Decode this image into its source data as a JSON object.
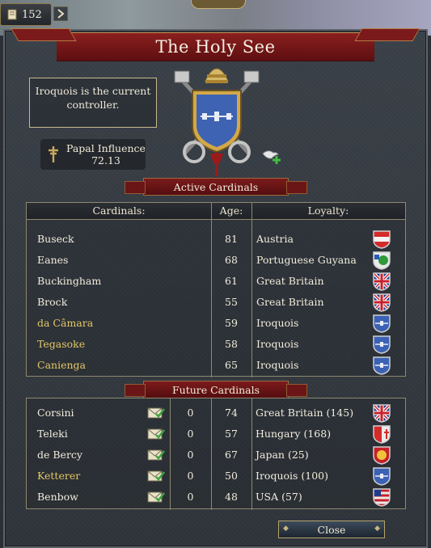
{
  "topbar": {
    "counter": "152"
  },
  "window": {
    "title": "The Holy See",
    "controller_text": "Iroquois is the current controller.",
    "influence_label": "Papal Influence",
    "influence_value": "72.13",
    "close_label": "Close"
  },
  "active": {
    "banner": "Active Cardinals",
    "headers": {
      "name": "Cardinals:",
      "age": "Age:",
      "loyalty": "Loyalty:"
    },
    "rows": [
      {
        "name": "Buseck",
        "age": "81",
        "loyalty": "Austria",
        "highlight": false,
        "flag": "austria"
      },
      {
        "name": "Eanes",
        "age": "68",
        "loyalty": "Portuguese Guyana",
        "highlight": false,
        "flag": "portuguese-guyana"
      },
      {
        "name": "Buckingham",
        "age": "61",
        "loyalty": "Great Britain",
        "highlight": false,
        "flag": "great-britain"
      },
      {
        "name": "Brock",
        "age": "55",
        "loyalty": "Great Britain",
        "highlight": false,
        "flag": "great-britain"
      },
      {
        "name": "da Câmara",
        "age": "59",
        "loyalty": "Iroquois",
        "highlight": true,
        "flag": "iroquois"
      },
      {
        "name": "Tegasoke",
        "age": "58",
        "loyalty": "Iroquois",
        "highlight": true,
        "flag": "iroquois"
      },
      {
        "name": "Caniengа",
        "age": "65",
        "loyalty": "Iroquois",
        "highlight": true,
        "flag": "iroquois"
      }
    ]
  },
  "future": {
    "banner": "Future Cardinals",
    "rows": [
      {
        "name": "Corsini",
        "score": "0",
        "age": "74",
        "loyalty": "Great Britain (145)",
        "highlight": false,
        "flag": "great-britain"
      },
      {
        "name": "Teleki",
        "score": "0",
        "age": "57",
        "loyalty": "Hungary (168)",
        "highlight": false,
        "flag": "hungary"
      },
      {
        "name": "de Bercy",
        "score": "0",
        "age": "67",
        "loyalty": "Japan (25)",
        "highlight": false,
        "flag": "japan"
      },
      {
        "name": "Ketterer",
        "score": "0",
        "age": "50",
        "loyalty": "Iroquois (100)",
        "highlight": true,
        "flag": "iroquois"
      },
      {
        "name": "Benbow",
        "score": "0",
        "age": "48",
        "loyalty": "USA (57)",
        "highlight": false,
        "flag": "usa"
      }
    ]
  },
  "colors": {
    "accent_red": "#7c1b1c",
    "highlight_yellow": "#e3c765",
    "text": "#f1ecdc"
  }
}
